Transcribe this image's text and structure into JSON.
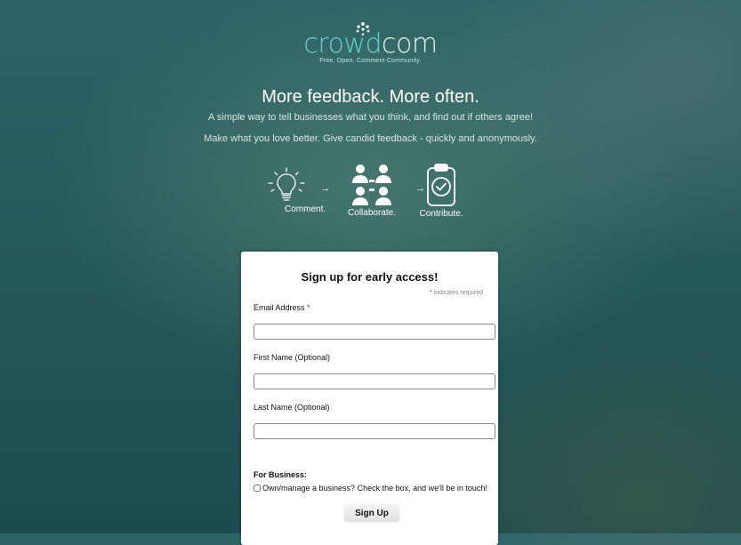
{
  "brand": {
    "name_part1": "crowd",
    "name_part2": "com",
    "tagline": "Free. Open. Comment Community."
  },
  "hero": {
    "headline": "More feedback. More often.",
    "subline1": "A simple way to tell businesses what you think, and find out if others agree!",
    "subline2": "Make what you love better. Give candid feedback - quickly and anonymously."
  },
  "steps": [
    {
      "label": "Comment.",
      "icon": "lightbulb-icon"
    },
    {
      "label": "Collaborate.",
      "icon": "people-icon"
    },
    {
      "label": "Contribute.",
      "icon": "clipboard-check-icon"
    }
  ],
  "arrow_glyph": "→",
  "signup": {
    "title": "Sign up for early access!",
    "required_star": "*",
    "required_note": "indicates required",
    "email_label": "Email Address",
    "email_value": "",
    "first_name_label": "First Name (Optional)",
    "first_name_value": "",
    "last_name_label": "Last Name (Optional)",
    "last_name_value": "",
    "business_heading": "For Business:",
    "business_checkbox_label": "Own/manage a business? Check the box, and we'll be in touch!",
    "business_checked": false,
    "submit_label": "Sign Up"
  },
  "colors": {
    "brand_teal": "#66cfcf",
    "required_red": "#d02a12",
    "background": "#26595a"
  }
}
